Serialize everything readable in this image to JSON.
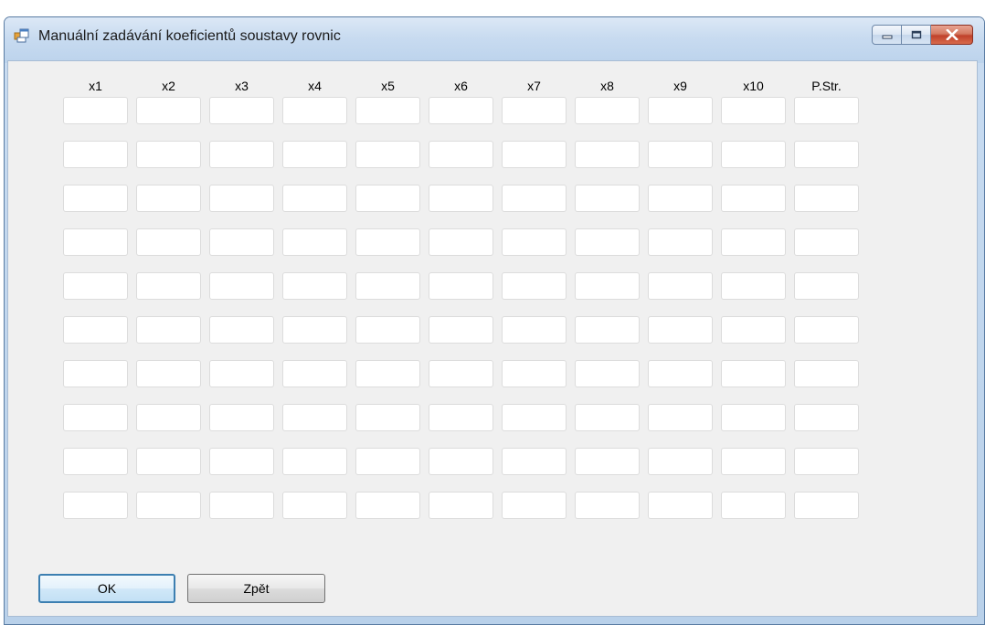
{
  "window": {
    "title": "Manuální zadávání koeficientů soustavy rovnic",
    "icon": "app-window-icon",
    "caption_buttons": [
      "minimize-icon",
      "maximize-icon",
      "close-icon"
    ]
  },
  "grid": {
    "columns": [
      "x1",
      "x2",
      "x3",
      "x4",
      "x5",
      "x6",
      "x7",
      "x8",
      "x9",
      "x10",
      "P.Str."
    ],
    "rows": 10,
    "cell_values": [
      [
        "",
        "",
        "",
        "",
        "",
        "",
        "",
        "",
        "",
        "",
        ""
      ],
      [
        "",
        "",
        "",
        "",
        "",
        "",
        "",
        "",
        "",
        "",
        ""
      ],
      [
        "",
        "",
        "",
        "",
        "",
        "",
        "",
        "",
        "",
        "",
        ""
      ],
      [
        "",
        "",
        "",
        "",
        "",
        "",
        "",
        "",
        "",
        "",
        ""
      ],
      [
        "",
        "",
        "",
        "",
        "",
        "",
        "",
        "",
        "",
        "",
        ""
      ],
      [
        "",
        "",
        "",
        "",
        "",
        "",
        "",
        "",
        "",
        "",
        ""
      ],
      [
        "",
        "",
        "",
        "",
        "",
        "",
        "",
        "",
        "",
        "",
        ""
      ],
      [
        "",
        "",
        "",
        "",
        "",
        "",
        "",
        "",
        "",
        "",
        ""
      ],
      [
        "",
        "",
        "",
        "",
        "",
        "",
        "",
        "",
        "",
        "",
        ""
      ],
      [
        "",
        "",
        "",
        "",
        "",
        "",
        "",
        "",
        "",
        "",
        ""
      ]
    ]
  },
  "buttons": {
    "ok_label": "OK",
    "back_label": "Zpět"
  },
  "colors": {
    "titlebar": "#c8dbf0",
    "client_background": "#f0f0f0",
    "close_button": "#c0412b",
    "default_button_border": "#3c7fb1"
  }
}
